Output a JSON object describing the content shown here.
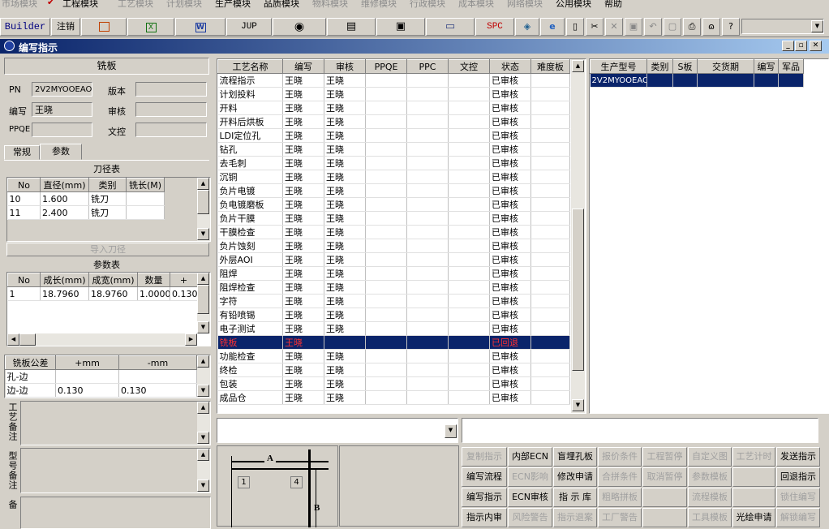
{
  "menu": [
    "市场模块",
    "✔",
    "工程模块",
    "工艺模块",
    "计划模块",
    "生产模块",
    "品质模块",
    "物料模块",
    "维修模块",
    "行政模块",
    "成本模块",
    "网络模块",
    "公用模块",
    "帮助"
  ],
  "toolbar": {
    "builder": "Builder",
    "logout": "注销",
    "jup": "JUP",
    "spc": "SPC"
  },
  "window": {
    "title": "编写指示"
  },
  "left": {
    "header": "铣板",
    "pn_label": "PN",
    "pn_value": "2V2MYOOEAO",
    "version_label": "版本",
    "version_value": "",
    "writer_label": "编写",
    "writer_value": "王晓",
    "reviewer_label": "审核",
    "reviewer_value": "",
    "ppqe_label": "PPQE",
    "ppqe_value": "",
    "doc_label": "文控",
    "doc_value": "",
    "tabs": [
      "常规",
      "参数"
    ],
    "tool_title": "刀径表",
    "tool_headers": [
      "No",
      "直径(mm)",
      "类别",
      "铣长(M)"
    ],
    "tool_rows": [
      [
        "10",
        "1.600",
        "铣刀",
        ""
      ],
      [
        "11",
        "2.400",
        "铣刀",
        ""
      ]
    ],
    "import_btn": "导入刀径",
    "param_title": "参数表",
    "param_headers": [
      "No",
      "成长(mm)",
      "成宽(mm)",
      "数量",
      "+"
    ],
    "param_rows": [
      [
        "1",
        "18.7960",
        "18.9760",
        "1.0000",
        "0.130"
      ]
    ],
    "tol_headers": [
      "铣板公差",
      "+mm",
      "-mm"
    ],
    "tol_rows": [
      [
        "孔-边",
        "",
        ""
      ],
      [
        "边-边",
        "0.130",
        "0.130"
      ]
    ],
    "notes": [
      "工艺备注",
      "型号备注",
      "订单备"
    ]
  },
  "process": {
    "headers": [
      "工艺名称",
      "编写",
      "审核",
      "PPQE",
      "PPC",
      "文控",
      "状态",
      "难度板"
    ],
    "rows": [
      [
        "流程指示",
        "王晓",
        "王晓",
        "",
        "",
        "",
        "已审核",
        ""
      ],
      [
        "计划投料",
        "王晓",
        "王晓",
        "",
        "",
        "",
        "已审核",
        ""
      ],
      [
        "开料",
        "王晓",
        "王晓",
        "",
        "",
        "",
        "已审核",
        ""
      ],
      [
        "开料后烘板",
        "王晓",
        "王晓",
        "",
        "",
        "",
        "已审核",
        ""
      ],
      [
        "LDI定位孔",
        "王晓",
        "王晓",
        "",
        "",
        "",
        "已审核",
        ""
      ],
      [
        "钻孔",
        "王晓",
        "王晓",
        "",
        "",
        "",
        "已审核",
        ""
      ],
      [
        "去毛刺",
        "王晓",
        "王晓",
        "",
        "",
        "",
        "已审核",
        ""
      ],
      [
        "沉铜",
        "王晓",
        "王晓",
        "",
        "",
        "",
        "已审核",
        ""
      ],
      [
        "负片电镀",
        "王晓",
        "王晓",
        "",
        "",
        "",
        "已审核",
        ""
      ],
      [
        "负电镀磨板",
        "王晓",
        "王晓",
        "",
        "",
        "",
        "已审核",
        ""
      ],
      [
        "负片干膜",
        "王晓",
        "王晓",
        "",
        "",
        "",
        "已审核",
        ""
      ],
      [
        "干膜检查",
        "王晓",
        "王晓",
        "",
        "",
        "",
        "已审核",
        ""
      ],
      [
        "负片蚀刻",
        "王晓",
        "王晓",
        "",
        "",
        "",
        "已审核",
        ""
      ],
      [
        "外层AOI",
        "王晓",
        "王晓",
        "",
        "",
        "",
        "已审核",
        ""
      ],
      [
        "阻焊",
        "王晓",
        "王晓",
        "",
        "",
        "",
        "已审核",
        ""
      ],
      [
        "阻焊检查",
        "王晓",
        "王晓",
        "",
        "",
        "",
        "已审核",
        ""
      ],
      [
        "字符",
        "王晓",
        "王晓",
        "",
        "",
        "",
        "已审核",
        ""
      ],
      [
        "有铅喷锡",
        "王晓",
        "王晓",
        "",
        "",
        "",
        "已审核",
        ""
      ],
      [
        "电子测试",
        "王晓",
        "王晓",
        "",
        "",
        "",
        "已审核",
        ""
      ],
      [
        "铣板",
        "王晓",
        "",
        "",
        "",
        "",
        "已回退",
        ""
      ],
      [
        "功能检查",
        "王晓",
        "王晓",
        "",
        "",
        "",
        "已审核",
        ""
      ],
      [
        "终检",
        "王晓",
        "王晓",
        "",
        "",
        "",
        "已审核",
        ""
      ],
      [
        "包装",
        "王晓",
        "王晓",
        "",
        "",
        "",
        "已审核",
        ""
      ],
      [
        "成品仓",
        "王晓",
        "王晓",
        "",
        "",
        "",
        "已审核",
        ""
      ]
    ],
    "selected": 19
  },
  "models": {
    "headers": [
      "生产型号",
      "类别",
      "S板",
      "交货期",
      "编写",
      "军品"
    ],
    "rows": [
      [
        "2V2MYOOEAO",
        "",
        "",
        "",
        "",
        ""
      ]
    ]
  },
  "diagram": {
    "a": "A",
    "b": "B",
    "n1": "1",
    "n4": "4"
  },
  "actions": [
    [
      "复制指示",
      "内部ECN",
      "盲埋孔板",
      "报价条件",
      "工程暂停",
      "自定义图",
      "工艺计时",
      "发送指示"
    ],
    [
      "编写流程",
      "ECN影响",
      "修改申请",
      "合拼条件",
      "取消暂停",
      "参数模板",
      "",
      "回退指示"
    ],
    [
      "编写指示",
      "ECN审核",
      "指 示 库",
      "粗略拼板",
      "",
      "流程模板",
      "",
      "锁住编写"
    ],
    [
      "指示内审",
      "风险警告",
      "指示退案",
      "工厂警告",
      "",
      "工具模板",
      "光绘申请",
      "解锁编写"
    ]
  ],
  "action_enabled": [
    [
      false,
      true,
      true,
      false,
      false,
      false,
      false,
      true
    ],
    [
      true,
      false,
      true,
      false,
      false,
      false,
      false,
      true
    ],
    [
      true,
      true,
      true,
      false,
      false,
      false,
      false,
      false
    ],
    [
      true,
      false,
      false,
      false,
      false,
      false,
      true,
      false
    ]
  ]
}
